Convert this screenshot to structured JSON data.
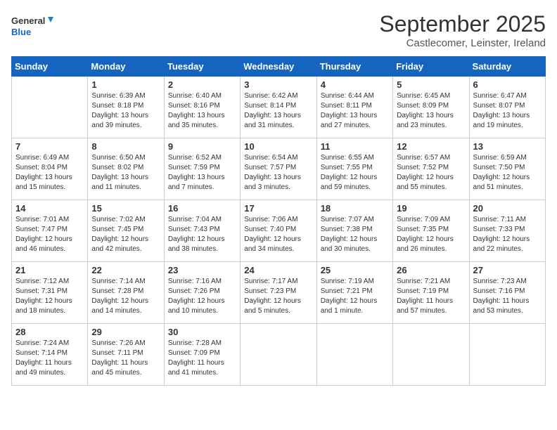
{
  "header": {
    "logo_general": "General",
    "logo_blue": "Blue",
    "month": "September 2025",
    "location": "Castlecomer, Leinster, Ireland"
  },
  "days_of_week": [
    "Sunday",
    "Monday",
    "Tuesday",
    "Wednesday",
    "Thursday",
    "Friday",
    "Saturday"
  ],
  "weeks": [
    [
      {
        "day": "",
        "info": ""
      },
      {
        "day": "1",
        "info": "Sunrise: 6:39 AM\nSunset: 8:18 PM\nDaylight: 13 hours\nand 39 minutes."
      },
      {
        "day": "2",
        "info": "Sunrise: 6:40 AM\nSunset: 8:16 PM\nDaylight: 13 hours\nand 35 minutes."
      },
      {
        "day": "3",
        "info": "Sunrise: 6:42 AM\nSunset: 8:14 PM\nDaylight: 13 hours\nand 31 minutes."
      },
      {
        "day": "4",
        "info": "Sunrise: 6:44 AM\nSunset: 8:11 PM\nDaylight: 13 hours\nand 27 minutes."
      },
      {
        "day": "5",
        "info": "Sunrise: 6:45 AM\nSunset: 8:09 PM\nDaylight: 13 hours\nand 23 minutes."
      },
      {
        "day": "6",
        "info": "Sunrise: 6:47 AM\nSunset: 8:07 PM\nDaylight: 13 hours\nand 19 minutes."
      }
    ],
    [
      {
        "day": "7",
        "info": "Sunrise: 6:49 AM\nSunset: 8:04 PM\nDaylight: 13 hours\nand 15 minutes."
      },
      {
        "day": "8",
        "info": "Sunrise: 6:50 AM\nSunset: 8:02 PM\nDaylight: 13 hours\nand 11 minutes."
      },
      {
        "day": "9",
        "info": "Sunrise: 6:52 AM\nSunset: 7:59 PM\nDaylight: 13 hours\nand 7 minutes."
      },
      {
        "day": "10",
        "info": "Sunrise: 6:54 AM\nSunset: 7:57 PM\nDaylight: 13 hours\nand 3 minutes."
      },
      {
        "day": "11",
        "info": "Sunrise: 6:55 AM\nSunset: 7:55 PM\nDaylight: 12 hours\nand 59 minutes."
      },
      {
        "day": "12",
        "info": "Sunrise: 6:57 AM\nSunset: 7:52 PM\nDaylight: 12 hours\nand 55 minutes."
      },
      {
        "day": "13",
        "info": "Sunrise: 6:59 AM\nSunset: 7:50 PM\nDaylight: 12 hours\nand 51 minutes."
      }
    ],
    [
      {
        "day": "14",
        "info": "Sunrise: 7:01 AM\nSunset: 7:47 PM\nDaylight: 12 hours\nand 46 minutes."
      },
      {
        "day": "15",
        "info": "Sunrise: 7:02 AM\nSunset: 7:45 PM\nDaylight: 12 hours\nand 42 minutes."
      },
      {
        "day": "16",
        "info": "Sunrise: 7:04 AM\nSunset: 7:43 PM\nDaylight: 12 hours\nand 38 minutes."
      },
      {
        "day": "17",
        "info": "Sunrise: 7:06 AM\nSunset: 7:40 PM\nDaylight: 12 hours\nand 34 minutes."
      },
      {
        "day": "18",
        "info": "Sunrise: 7:07 AM\nSunset: 7:38 PM\nDaylight: 12 hours\nand 30 minutes."
      },
      {
        "day": "19",
        "info": "Sunrise: 7:09 AM\nSunset: 7:35 PM\nDaylight: 12 hours\nand 26 minutes."
      },
      {
        "day": "20",
        "info": "Sunrise: 7:11 AM\nSunset: 7:33 PM\nDaylight: 12 hours\nand 22 minutes."
      }
    ],
    [
      {
        "day": "21",
        "info": "Sunrise: 7:12 AM\nSunset: 7:31 PM\nDaylight: 12 hours\nand 18 minutes."
      },
      {
        "day": "22",
        "info": "Sunrise: 7:14 AM\nSunset: 7:28 PM\nDaylight: 12 hours\nand 14 minutes."
      },
      {
        "day": "23",
        "info": "Sunrise: 7:16 AM\nSunset: 7:26 PM\nDaylight: 12 hours\nand 10 minutes."
      },
      {
        "day": "24",
        "info": "Sunrise: 7:17 AM\nSunset: 7:23 PM\nDaylight: 12 hours\nand 5 minutes."
      },
      {
        "day": "25",
        "info": "Sunrise: 7:19 AM\nSunset: 7:21 PM\nDaylight: 12 hours\nand 1 minute."
      },
      {
        "day": "26",
        "info": "Sunrise: 7:21 AM\nSunset: 7:19 PM\nDaylight: 11 hours\nand 57 minutes."
      },
      {
        "day": "27",
        "info": "Sunrise: 7:23 AM\nSunset: 7:16 PM\nDaylight: 11 hours\nand 53 minutes."
      }
    ],
    [
      {
        "day": "28",
        "info": "Sunrise: 7:24 AM\nSunset: 7:14 PM\nDaylight: 11 hours\nand 49 minutes."
      },
      {
        "day": "29",
        "info": "Sunrise: 7:26 AM\nSunset: 7:11 PM\nDaylight: 11 hours\nand 45 minutes."
      },
      {
        "day": "30",
        "info": "Sunrise: 7:28 AM\nSunset: 7:09 PM\nDaylight: 11 hours\nand 41 minutes."
      },
      {
        "day": "",
        "info": ""
      },
      {
        "day": "",
        "info": ""
      },
      {
        "day": "",
        "info": ""
      },
      {
        "day": "",
        "info": ""
      }
    ]
  ]
}
